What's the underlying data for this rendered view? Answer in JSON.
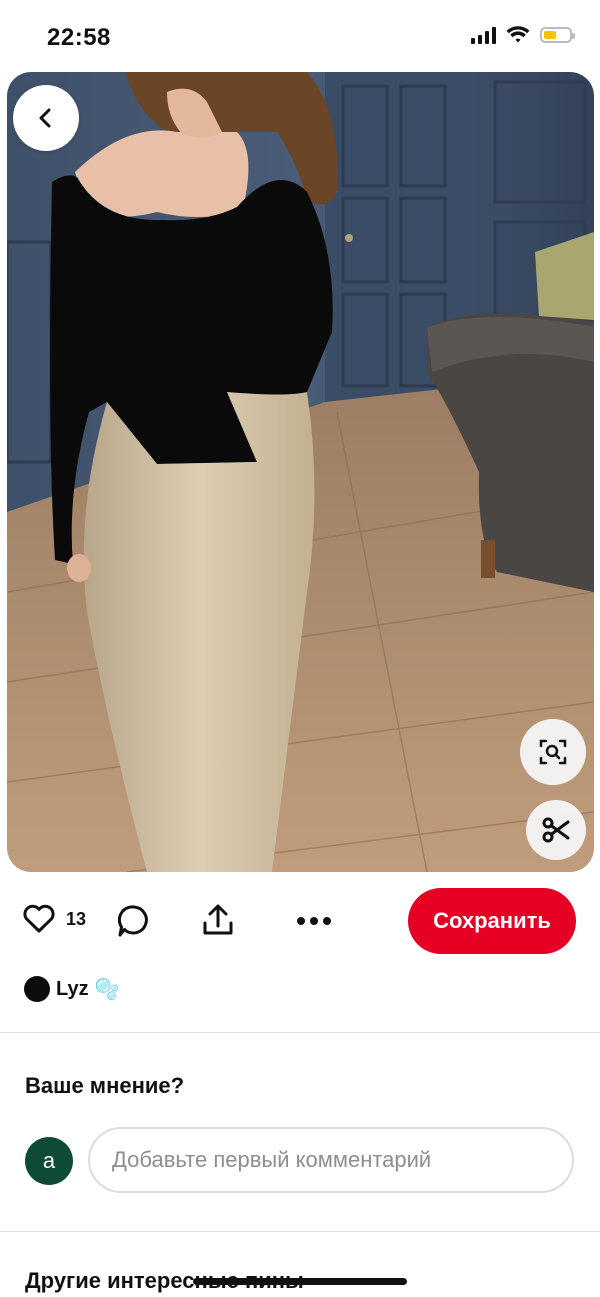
{
  "status_bar": {
    "time": "22:58",
    "battery_color": "#f5c400"
  },
  "pin": {
    "back_icon": "chevron-left-icon",
    "visual_search_icon": "lens-icon",
    "cut_icon": "scissors-icon"
  },
  "actions": {
    "like_icon": "heart-icon",
    "like_count": "13",
    "comment_icon": "speech-bubble-icon",
    "share_icon": "upload-icon",
    "more_icon": "ellipsis-icon",
    "save_label": "Сохранить",
    "save_color": "#e60023"
  },
  "author": {
    "name": "Lyz",
    "badge": "🫧"
  },
  "comments": {
    "title": "Ваше мнение?",
    "user_initial": "a",
    "avatar_color": "#0d4b36",
    "input_placeholder": "Добавьте первый комментарий"
  },
  "more_pins": {
    "title": "Другие интересные пины"
  }
}
